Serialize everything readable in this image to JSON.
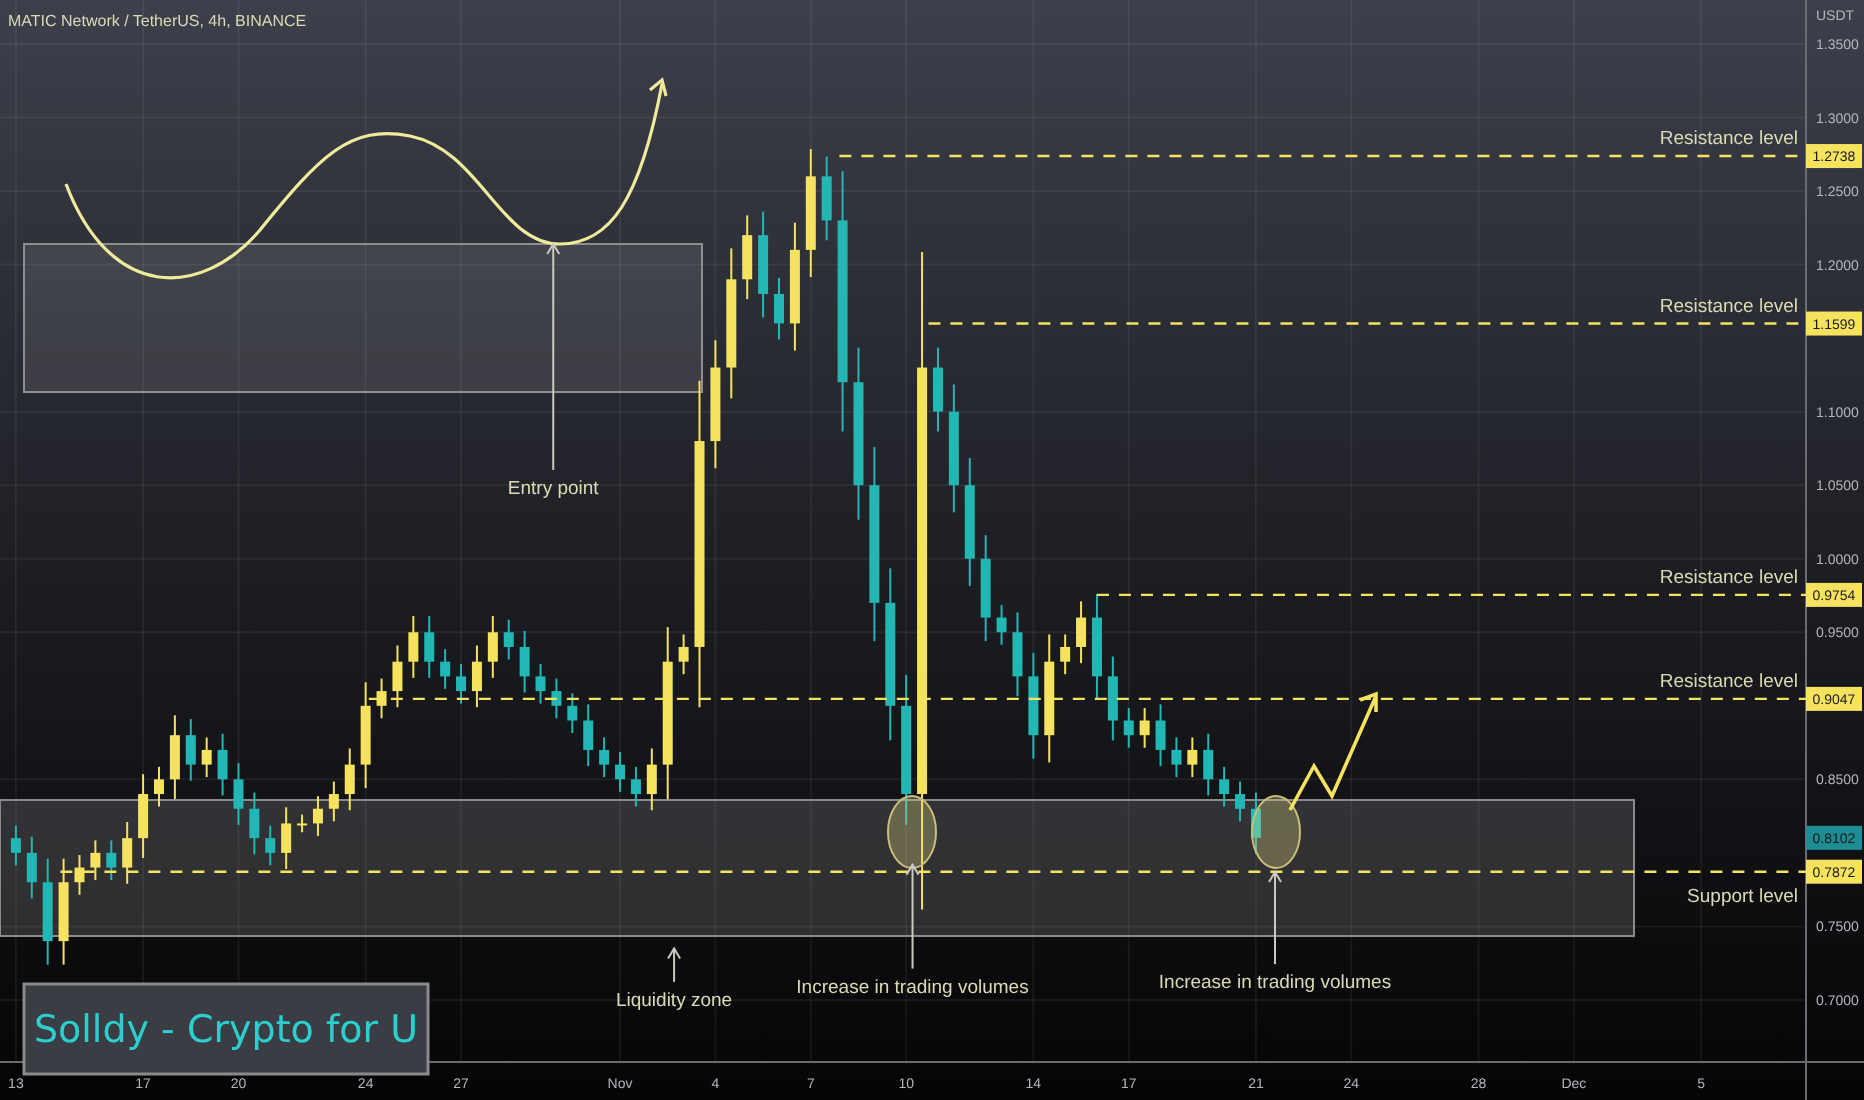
{
  "header": {
    "title": "MATIC Network / TetherUS, 4h, BINANCE"
  },
  "price_axis": {
    "unit": "USDT",
    "ticks": [
      "1.3500",
      "1.3000",
      "1.2500",
      "1.2000",
      "1.1000",
      "1.0500",
      "1.0000",
      "0.9500",
      "0.8500",
      "0.7500",
      "0.7000"
    ]
  },
  "time_axis": {
    "ticks": [
      "13",
      "17",
      "20",
      "24",
      "27",
      "Nov",
      "4",
      "7",
      "10",
      "14",
      "17",
      "21",
      "24",
      "28",
      "Dec",
      "5"
    ]
  },
  "levels": [
    {
      "kind": "resistance",
      "label": "Resistance level",
      "tag": "1.2738"
    },
    {
      "kind": "resistance",
      "label": "Resistance level",
      "tag": "1.1599"
    },
    {
      "kind": "resistance",
      "label": "Resistance level",
      "tag": "0.9754"
    },
    {
      "kind": "resistance",
      "label": "Resistance level",
      "tag": "0.9047"
    },
    {
      "kind": "support",
      "label": "Support level",
      "tag": "0.7872"
    }
  ],
  "current_price": {
    "tag": "0.8102"
  },
  "notes": [
    {
      "label": "Entry point"
    },
    {
      "label": "Liquidity zone"
    },
    {
      "label": "Increase in trading volumes"
    },
    {
      "label": "Increase in trading volumes"
    }
  ],
  "branding": {
    "text": "Solldy - Crypto for U"
  }
}
